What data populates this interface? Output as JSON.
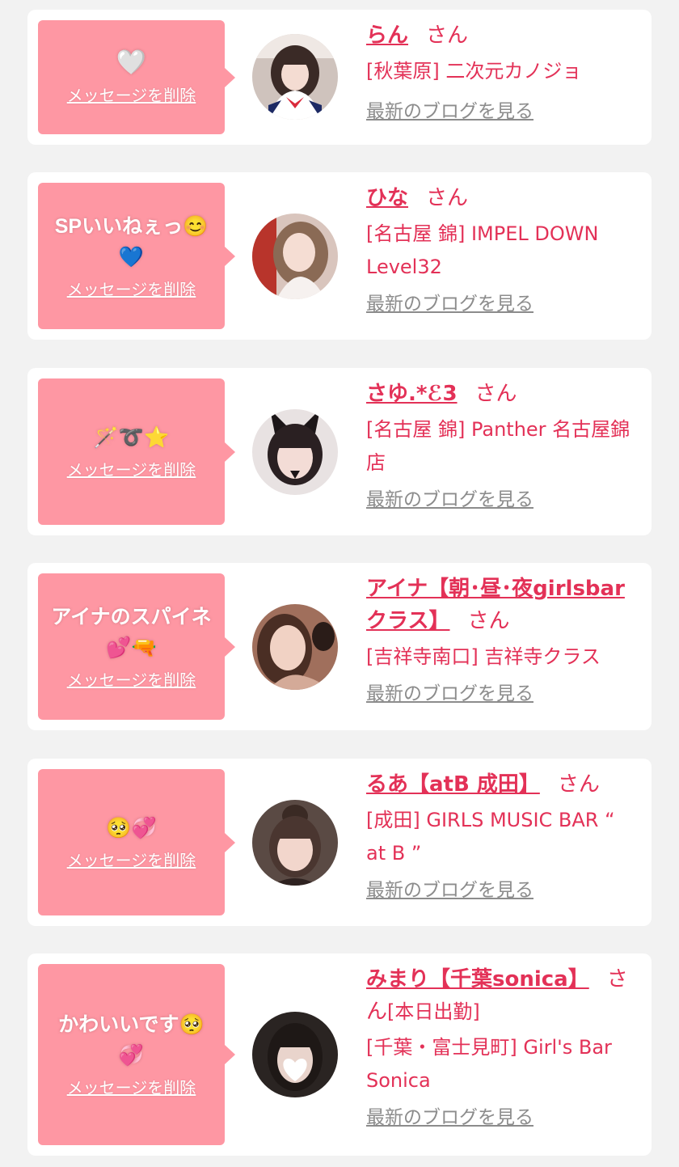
{
  "colors": {
    "background": "#f2f2f2",
    "card": "#ffffff",
    "bubble": "#fe97a3",
    "accent": "#e33157",
    "link_gray": "#8c8c8c"
  },
  "cards": [
    {
      "message": "🤍",
      "message_icons": [
        "white-heart-icon"
      ],
      "delete_label": "メッセージを削除",
      "name": "らん",
      "honorific": "さん",
      "shop": "[秋葉原] 二次元カノジョ",
      "blog_label": "最新のブログを見る"
    },
    {
      "message": "SPいいねぇっ😊💙",
      "message_icons": [
        "smiling-face-icon",
        "blue-heart-icon"
      ],
      "delete_label": "メッセージを削除",
      "name": "ひな",
      "honorific": "さん",
      "shop": "[名古屋 錦] IMPEL DOWN Level32",
      "blog_label": "最新のブログを見る"
    },
    {
      "message": "🪄➰⭐️",
      "message_icons": [
        "magic-wand-icon",
        "curly-loop-icon",
        "star-icon"
      ],
      "delete_label": "メッセージを削除",
      "name": "さゆ.*ℰ3",
      "honorific": "さん",
      "shop": "[名古屋 錦] Panther 名古屋錦店",
      "blog_label": "最新のブログを見る"
    },
    {
      "message": "アイナのスパイネ💕🔫",
      "message_icons": [
        "two-hearts-icon",
        "water-pistol-icon"
      ],
      "delete_label": "メッセージを削除",
      "name": "アイナ【朝･昼･夜girlsbarクラス】",
      "honorific": "さん",
      "shop": "[吉祥寺南口] 吉祥寺クラス",
      "blog_label": "最新のブログを見る"
    },
    {
      "message": "🥺💞",
      "message_icons": [
        "pleading-face-icon",
        "revolving-hearts-icon"
      ],
      "delete_label": "メッセージを削除",
      "name": "るあ【atB 成田】",
      "honorific": "さん",
      "shop": "[成田] GIRLS MUSIC BAR “ at B ”",
      "blog_label": "最新のブログを見る"
    },
    {
      "message": "かわいいです🥺💞",
      "message_icons": [
        "pleading-face-icon",
        "revolving-hearts-icon"
      ],
      "delete_label": "メッセージを削除",
      "name": "みまり【千葉sonica】",
      "honorific": "さん",
      "status": "[本日出勤]",
      "shop": "[千葉・富士見町] Girl's Bar Sonica",
      "blog_label": "最新のブログを見る"
    }
  ]
}
